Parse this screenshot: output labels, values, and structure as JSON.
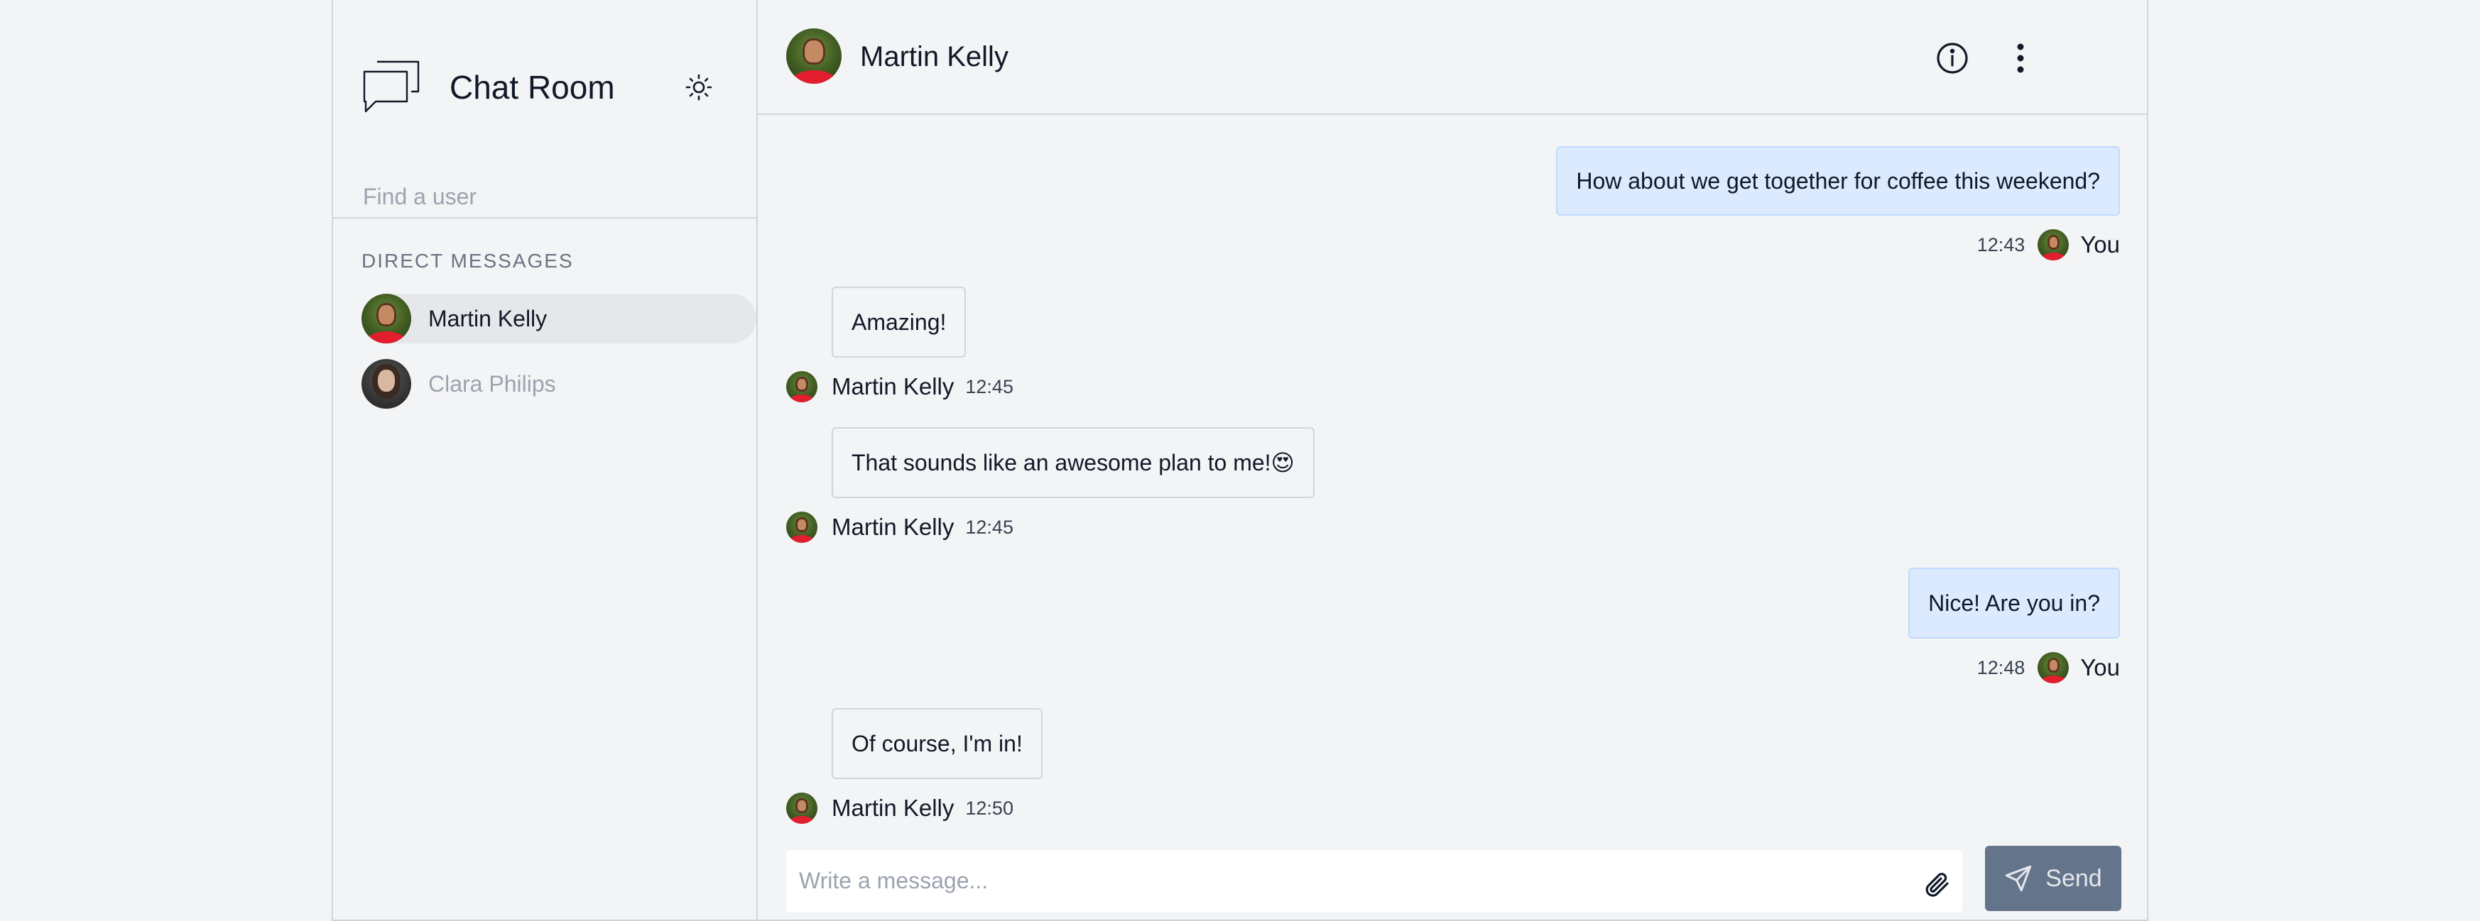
{
  "sidebar": {
    "app_title": "Chat Room",
    "logo_icon": "chat-bubbles-icon",
    "theme_icon": "sun-icon",
    "search": {
      "placeholder": "Find a user",
      "value": ""
    },
    "section_title": "DIRECT MESSAGES",
    "contacts": [
      {
        "name": "Martin Kelly",
        "active": true
      },
      {
        "name": "Clara Philips",
        "active": false
      }
    ]
  },
  "header": {
    "contact_name": "Martin Kelly",
    "info_icon": "info-icon",
    "menu_icon": "more-vertical-icon"
  },
  "messages": [
    {
      "direction": "out",
      "text": "How about we get together for coffee this weekend?",
      "time": "12:43",
      "author": "You"
    },
    {
      "direction": "in",
      "text": "Amazing!",
      "time": "12:45",
      "author": "Martin Kelly"
    },
    {
      "direction": "in",
      "text": "That sounds like an awesome plan to me!😍",
      "time": "12:45",
      "author": "Martin Kelly"
    },
    {
      "direction": "out",
      "text": "Nice! Are you in?",
      "time": "12:48",
      "author": "You"
    },
    {
      "direction": "in",
      "text": "Of course, I'm in!",
      "time": "12:50",
      "author": "Martin Kelly"
    }
  ],
  "composer": {
    "placeholder": "Write a message...",
    "value": "",
    "attach_icon": "paperclip-icon",
    "send_icon": "paper-plane-icon",
    "send_label": "Send"
  },
  "colors": {
    "background": "#f3f4f6",
    "outgoing_bubble": "#dbeafe",
    "send_button": "#64748b",
    "active_contact": "#e5e7eb"
  }
}
